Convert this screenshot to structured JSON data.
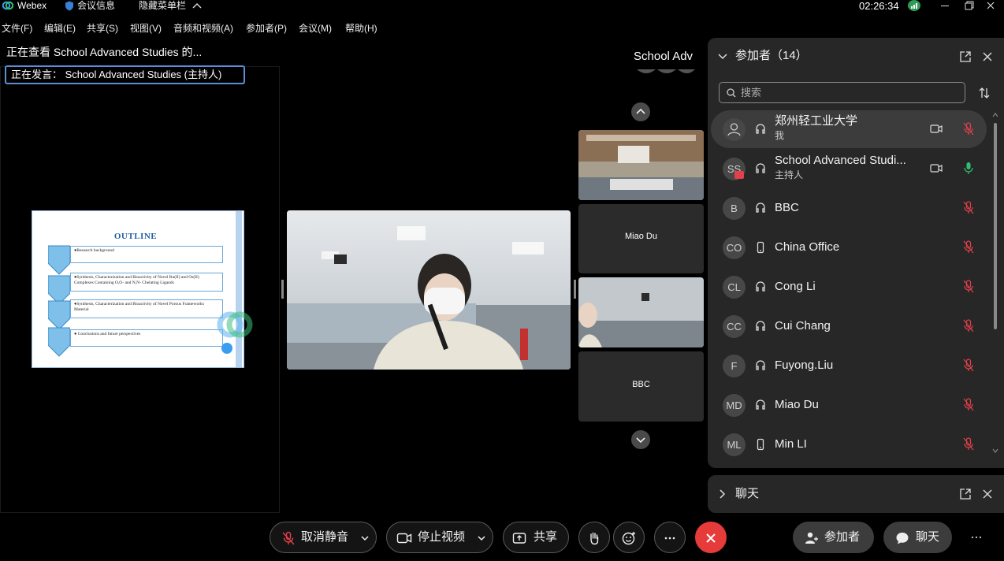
{
  "titlebar": {
    "app_name": "Webex",
    "meeting_info": "会议信息",
    "hide_menu": "隐藏菜单栏",
    "clock": "02:26:34"
  },
  "menu": [
    "文件(F)",
    "编辑(E)",
    "共享(S)",
    "视图(V)",
    "音频和视频(A)",
    "参加者(P)",
    "会议(M)",
    "帮助(H)"
  ],
  "share": {
    "viewing_text": "正在查看 School Advanced Studies 的...",
    "speaking_text": "正在发言： School Advanced Studies (主持人)",
    "slide": {
      "title": "OUTLINE",
      "items": [
        "●Research background",
        "●Synthesis, Characterization and Bioactivity of Novel Ru(II) and Os(II) Complexes Containing O,O- and N,N- Chelating Ligands",
        "●Synthesis, Characterization and Bioactivity of Novel Porous Frameworks Material",
        "●  Conclusions and future perspectives"
      ]
    }
  },
  "stage": {
    "name": "School Adv",
    "tiles": [
      "Miao Du",
      "BBC"
    ]
  },
  "participants": {
    "header": "参加者（14）",
    "search_placeholder": "搜索",
    "list": [
      {
        "initials": "",
        "name": "郑州轻工业大学",
        "sub": "我",
        "video": true,
        "mic": "muted",
        "device": "headset"
      },
      {
        "initials": "SS",
        "name": "School Advanced Studi...",
        "sub": "主持人",
        "video": true,
        "mic": "on",
        "device": "headset"
      },
      {
        "initials": "B",
        "name": "BBC",
        "sub": "",
        "video": false,
        "mic": "muted",
        "device": "headset"
      },
      {
        "initials": "CO",
        "name": "China Office",
        "sub": "",
        "video": false,
        "mic": "muted",
        "device": "phone"
      },
      {
        "initials": "CL",
        "name": "Cong Li",
        "sub": "",
        "video": false,
        "mic": "muted",
        "device": "headset"
      },
      {
        "initials": "CC",
        "name": "Cui Chang",
        "sub": "",
        "video": false,
        "mic": "muted",
        "device": "headset"
      },
      {
        "initials": "F",
        "name": "Fuyong.Liu",
        "sub": "",
        "video": false,
        "mic": "muted",
        "device": "headset"
      },
      {
        "initials": "MD",
        "name": "Miao Du",
        "sub": "",
        "video": false,
        "mic": "muted",
        "device": "headset"
      },
      {
        "initials": "ML",
        "name": "Min LI",
        "sub": "",
        "video": false,
        "mic": "muted",
        "device": "phone"
      }
    ]
  },
  "chat": {
    "header": "聊天"
  },
  "controls": {
    "unmute": "取消静音",
    "stop_video": "停止视频",
    "share": "共享",
    "participants": "参加者",
    "chat": "聊天"
  },
  "colors": {
    "muted_mic": "#e2404b",
    "active_mic": "#2fbf71",
    "leave": "#e63b3b",
    "accent_border": "#5a8fd6"
  }
}
